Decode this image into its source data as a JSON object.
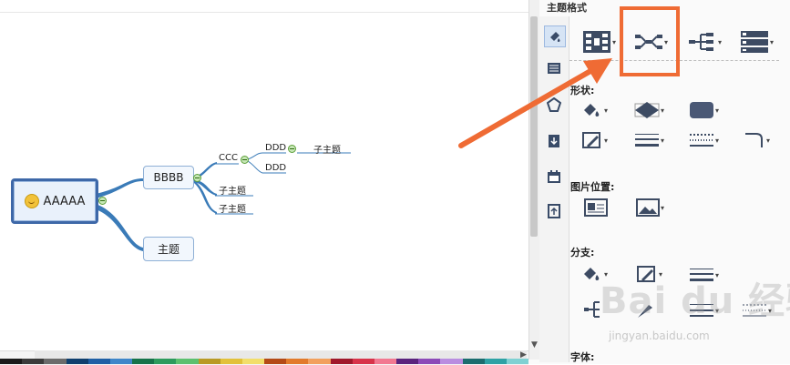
{
  "panel": {
    "title": "主题格式",
    "corner_char": "\u0000",
    "sections": {
      "shape": "形状:",
      "image_position": "图片位置:",
      "branch": "分支:",
      "font": "字体:"
    }
  },
  "mindmap": {
    "root": "AAAAA",
    "bbbb": "BBBB",
    "zhuti": "主题",
    "ccc": "CCC",
    "ddd1": "DDD",
    "ddd2": "DDD",
    "ddd_child": "子主题",
    "sub1": "子主题",
    "sub2": "子主题"
  },
  "watermark": {
    "main": "Bai du 经验",
    "url": "jingyan.baidu.com"
  },
  "colors": {
    "highlight": "#ef6b34",
    "branch": "#3a7bb8",
    "root_border": "#3e68a8"
  },
  "icons": [
    "paint-bucket-icon",
    "list-icon",
    "pentagon-icon",
    "download-icon",
    "calendar-icon",
    "upload-icon"
  ]
}
